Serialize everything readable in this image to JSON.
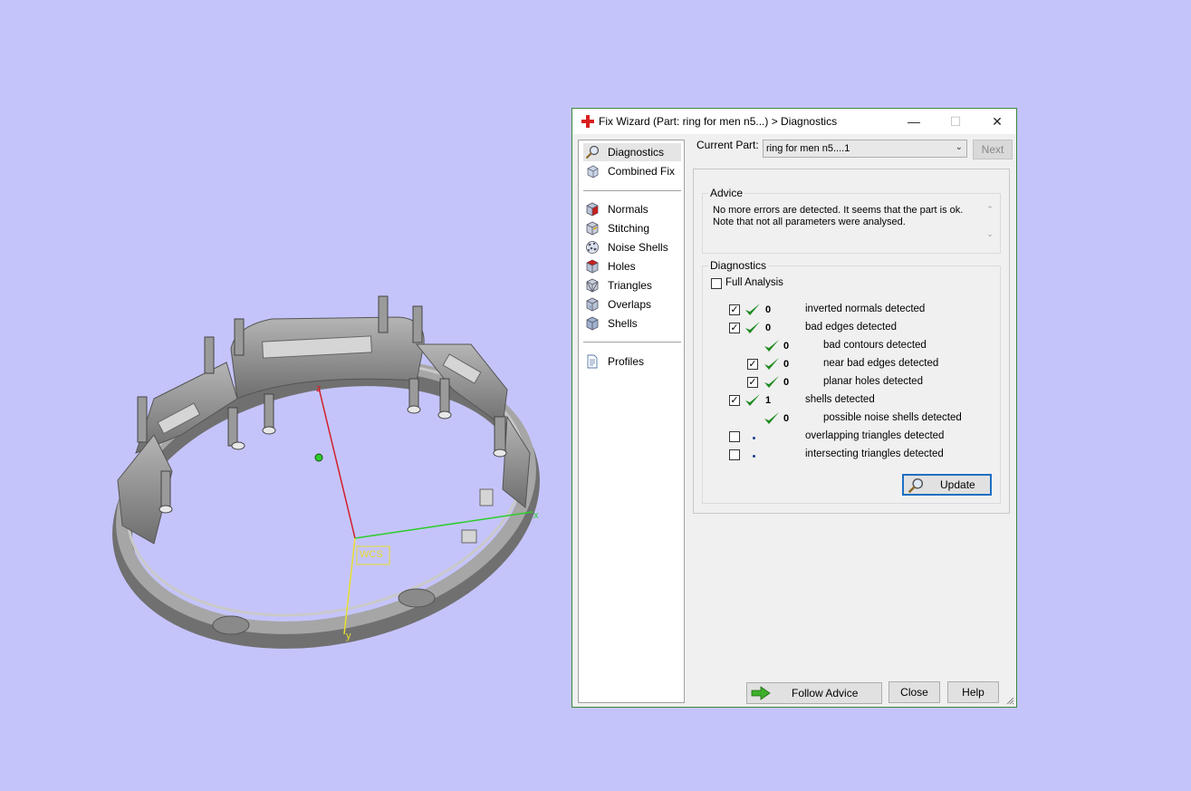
{
  "viewport": {
    "axis_x": "x",
    "axis_y": "y",
    "axis_z": "z",
    "wcs_label": "WCS",
    "colors": {
      "background": "#c5c4fa",
      "axis_x": "#2ecc2e",
      "axis_y": "#e8e030",
      "axis_z": "#d0202a",
      "model": "#8c8c8c"
    }
  },
  "window": {
    "title": "Fix Wizard (Part: ring for men n5...) > Diagnostics",
    "app_icon": "red-cross-icon",
    "controls": {
      "minimize": "—",
      "maximize": "☐",
      "close": "✕"
    }
  },
  "nav": {
    "items": [
      {
        "label": "Diagnostics",
        "icon": "magnifier-icon"
      },
      {
        "label": "Combined Fix",
        "icon": "cube-icon"
      },
      {
        "label": "Normals",
        "icon": "cube-red-face-icon"
      },
      {
        "label": "Stitching",
        "icon": "cube-stitch-icon"
      },
      {
        "label": "Noise Shells",
        "icon": "noise-shells-icon"
      },
      {
        "label": "Holes",
        "icon": "cube-hole-icon"
      },
      {
        "label": "Triangles",
        "icon": "cube-triangles-icon"
      },
      {
        "label": "Overlaps",
        "icon": "cube-overlap-icon"
      },
      {
        "label": "Shells",
        "icon": "shells-icon"
      },
      {
        "label": "Profiles",
        "icon": "document-icon"
      }
    ]
  },
  "header": {
    "current_part_label": "Current Part:",
    "current_part_value": "ring for men n5....1",
    "next_label": "Next"
  },
  "advice": {
    "legend": "Advice",
    "text": "No more errors are detected. It seems that the part is ok. Note that not all parameters were analysed."
  },
  "diagnostics": {
    "legend": "Diagnostics",
    "full_analysis_label": "Full Analysis",
    "rows": [
      {
        "count": "0",
        "label": "inverted normals detected"
      },
      {
        "count": "0",
        "label": "bad edges detected"
      },
      {
        "count": "0",
        "label": "bad contours detected"
      },
      {
        "count": "0",
        "label": "near bad edges detected"
      },
      {
        "count": "0",
        "label": "planar holes detected"
      },
      {
        "count": "1",
        "label": "shells detected"
      },
      {
        "count": "0",
        "label": "possible noise shells detected"
      },
      {
        "count": "",
        "label": "overlapping triangles detected"
      },
      {
        "count": "",
        "label": "intersecting triangles detected"
      }
    ],
    "update_label": "Update"
  },
  "footer": {
    "follow_advice_label": "Follow Advice",
    "close_label": "Close",
    "help_label": "Help"
  }
}
